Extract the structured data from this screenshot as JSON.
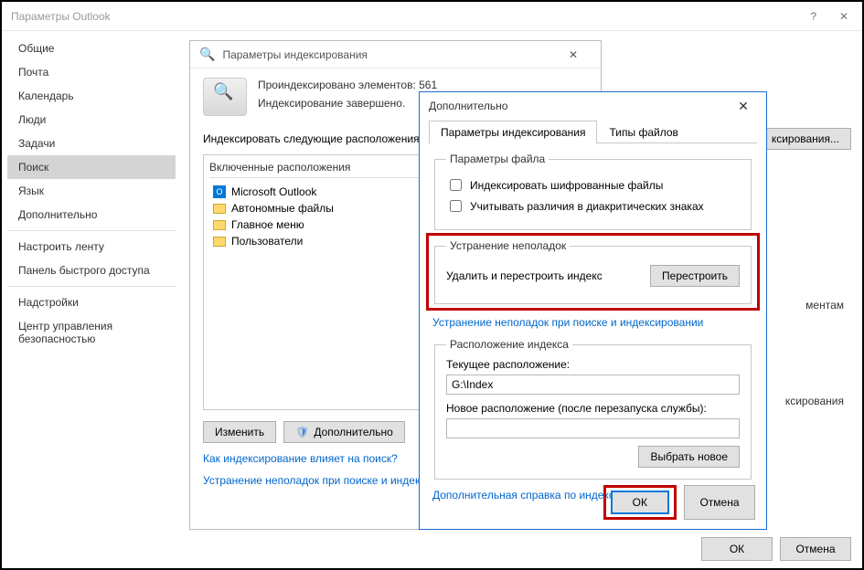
{
  "outlook": {
    "title": "Параметры Outlook",
    "help_icon": "?",
    "close_icon": "✕",
    "sidebar": [
      "Общие",
      "Почта",
      "Календарь",
      "Люди",
      "Задачи",
      "Поиск",
      "Язык",
      "Дополнительно",
      "Настроить ленту",
      "Панель быстрого доступа",
      "Надстройки",
      "Центр управления безопасностью"
    ],
    "sidebar_selected": 5,
    "indexing_options_btn": "ксирования...",
    "right_text_partial1": "ментам",
    "right_text_partial2": "ксирования",
    "ok": "ОК",
    "cancel": "Отмена"
  },
  "indexing": {
    "title": "Параметры индексирования",
    "close_icon": "✕",
    "indexed_count": "Проиндексировано элементов: 561",
    "status": "Индексирование завершено.",
    "locations_label": "Индексировать следующие расположения:",
    "locations_header": "Включенные расположения",
    "locations": [
      "Microsoft Outlook",
      "Автономные файлы",
      "Главное меню",
      "Пользователи"
    ],
    "modify_btn": "Изменить",
    "advanced_btn": "Дополнительно",
    "link1": "Как индексирование влияет на поиск?",
    "link2": "Устранение неполадок при поиске и индексиро"
  },
  "advanced": {
    "title": "Дополнительно",
    "close_icon": "✕",
    "tab1": "Параметры индексирования",
    "tab2": "Типы файлов",
    "file_params_legend": "Параметры файла",
    "encrypted_chk": "Индексировать шифрованные файлы",
    "diacritics_chk": "Учитывать различия в диакритических знаках",
    "trouble_legend": "Устранение неполадок",
    "rebuild_text": "Удалить и перестроить индекс",
    "rebuild_btn": "Перестроить",
    "trouble_link": "Устранение неполадок при поиске и индексировании",
    "location_legend": "Расположение индекса",
    "current_loc_label": "Текущее расположение:",
    "current_loc": "G:\\Index",
    "new_loc_label": "Новое расположение (после перезапуска службы):",
    "new_loc": "",
    "select_new_btn": "Выбрать новое",
    "help_link": "Дополнительная справка по индексированию",
    "ok": "ОК",
    "cancel": "Отмена"
  }
}
